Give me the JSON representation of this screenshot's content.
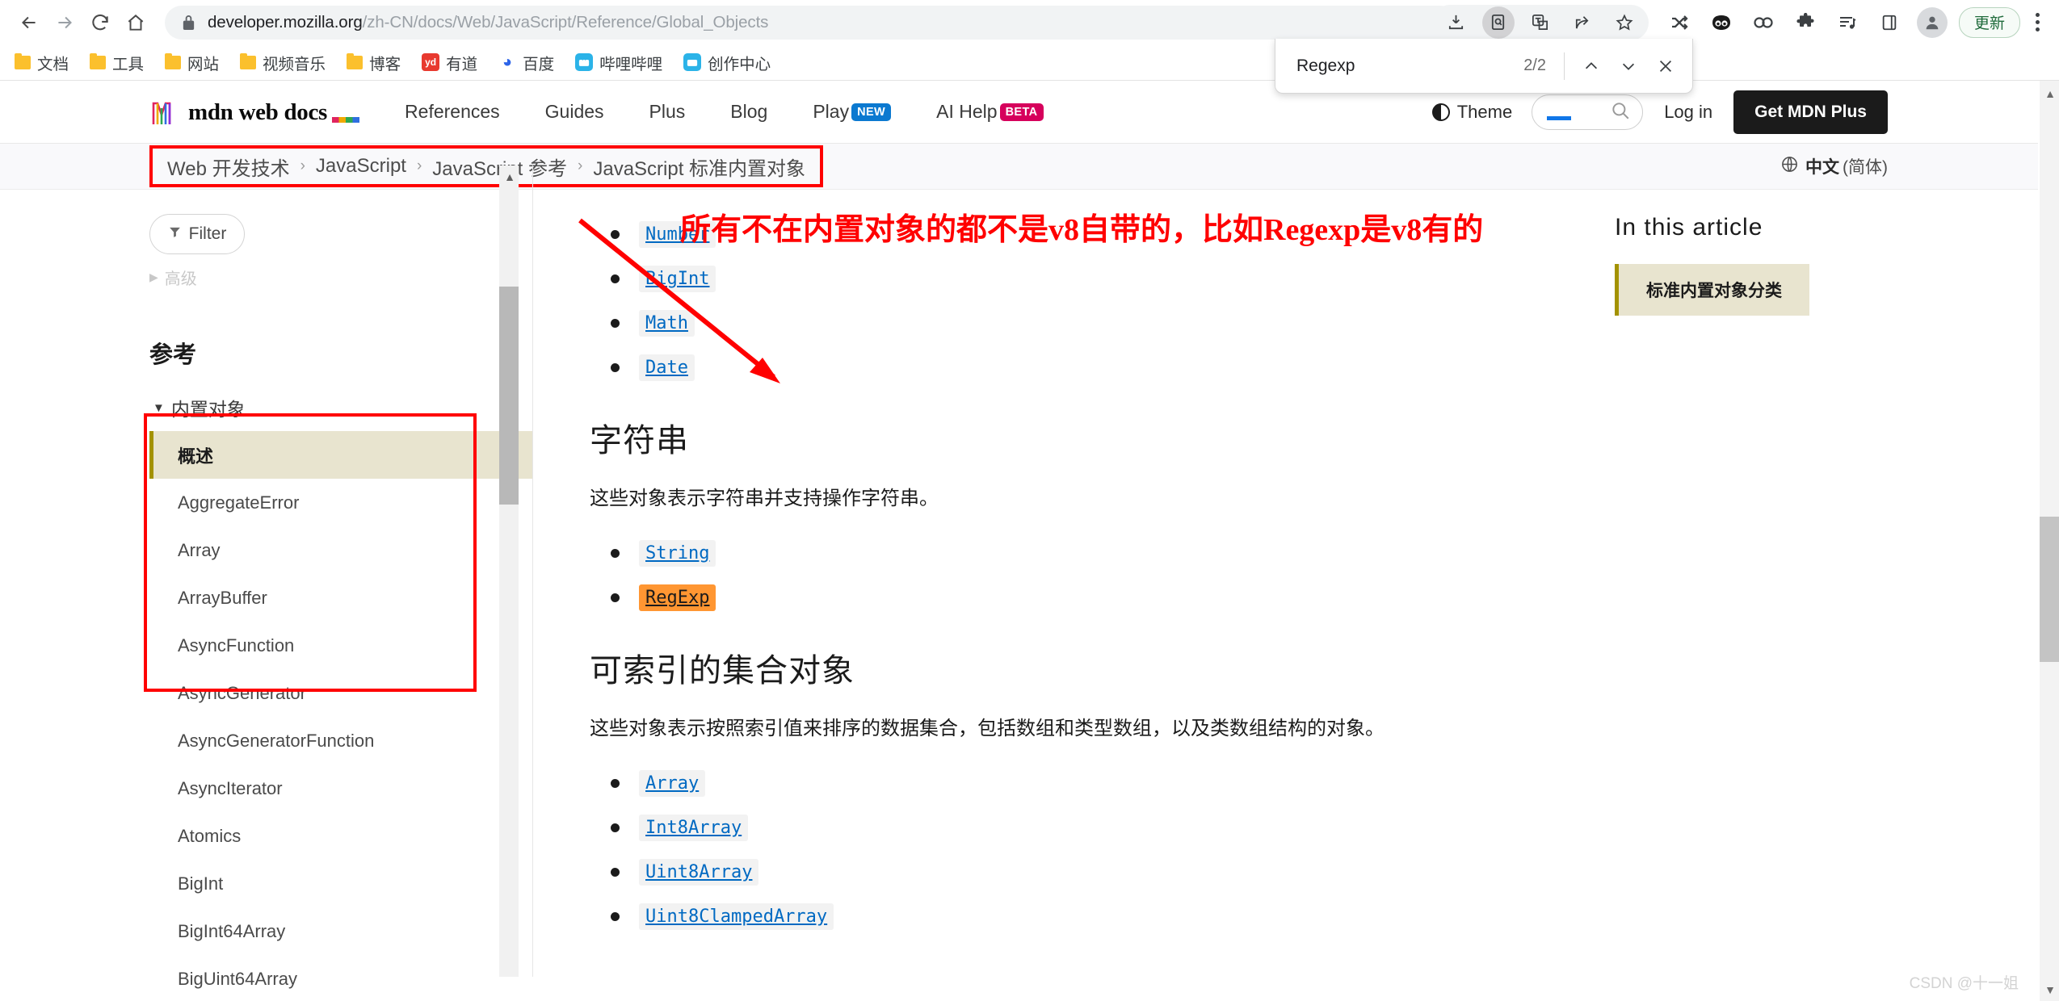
{
  "browser": {
    "nav": {
      "back": "back-arrow",
      "forward": "forward-arrow",
      "reload": "reload",
      "home": "home"
    },
    "url": {
      "host": "developer.mozilla.org",
      "path": "/zh-CN/docs/Web/JavaScript/Reference/Global_Objects",
      "lock_icon": "lock-icon"
    },
    "bookmarks": [
      {
        "label": "文档",
        "icon": "folder"
      },
      {
        "label": "工具",
        "icon": "folder"
      },
      {
        "label": "网站",
        "icon": "folder"
      },
      {
        "label": "视频音乐",
        "icon": "folder"
      },
      {
        "label": "博客",
        "icon": "folder"
      },
      {
        "label": "有道",
        "icon": "youdao",
        "icon_text": "yd",
        "color": "#e8392f"
      },
      {
        "label": "百度",
        "icon": "baidu",
        "icon_text": "",
        "color": "#2d64e8"
      },
      {
        "label": "哔哩哔哩",
        "icon": "bilibili",
        "icon_text": "",
        "color": "#2bb3e8"
      },
      {
        "label": "创作中心",
        "icon": "bilibili",
        "icon_text": "",
        "color": "#2bb3e8"
      }
    ],
    "toolbar_right": {
      "download_icon": "download-icon",
      "find_icon": "find-in-page-icon",
      "translate_icon": "translate-icon",
      "share_icon": "share-icon",
      "bookmark_icon": "star-icon",
      "shuffle_icon": "shuffle-icon",
      "panda_icon": "panda-icon",
      "link_icon": "link-icon",
      "extensions_icon": "puzzle-icon",
      "playlist_icon": "playlist-icon",
      "sidepanel_icon": "side-panel-icon",
      "profile_icon": "profile-avatar",
      "update_label": "更新",
      "menu_icon": "three-dots-menu"
    },
    "find_bar": {
      "query": "Regexp",
      "count": "2/2",
      "prev_icon": "chevron-up-icon",
      "next_icon": "chevron-down-icon",
      "close_icon": "close-icon"
    }
  },
  "mdn": {
    "logo_text": "mdn web docs",
    "nav": [
      {
        "label": "References",
        "badge": ""
      },
      {
        "label": "Guides",
        "badge": ""
      },
      {
        "label": "Plus",
        "badge": ""
      },
      {
        "label": "Blog",
        "badge": ""
      },
      {
        "label": "Play",
        "badge": "NEW"
      },
      {
        "label": "AI Help",
        "badge": "BETA"
      }
    ],
    "theme_label": "Theme",
    "search_icon": "search-icon",
    "login_label": "Log in",
    "get_plus_label": "Get MDN Plus",
    "breadcrumb": [
      "Web 开发技术",
      "JavaScript",
      "JavaScript 参考",
      "JavaScript 标准内置对象"
    ],
    "breadcrumb_separator": "›",
    "language": {
      "icon": "globe-icon",
      "name": "中文",
      "variant": "(简体)"
    }
  },
  "sidebar": {
    "filter_label": "Filter",
    "filter_icon": "filter-icon",
    "advanced_label": "高级",
    "section_title": "参考",
    "group_label": "内置对象",
    "items": [
      {
        "label": "概述",
        "current": true
      },
      {
        "label": "AggregateError",
        "current": false
      },
      {
        "label": "Array",
        "current": false
      },
      {
        "label": "ArrayBuffer",
        "current": false
      },
      {
        "label": "AsyncFunction",
        "current": false
      },
      {
        "label": "AsyncGenerator",
        "current": false
      },
      {
        "label": "AsyncGeneratorFunction",
        "current": false
      },
      {
        "label": "AsyncIterator",
        "current": false
      },
      {
        "label": "Atomics",
        "current": false
      },
      {
        "label": "BigInt",
        "current": false
      },
      {
        "label": "BigInt64Array",
        "current": false
      },
      {
        "label": "BigUint64Array",
        "current": false
      }
    ]
  },
  "main": {
    "annotation": "所有不在内置对象的都不是v8自带的，比如Regexp是v8有的",
    "top_list": [
      {
        "label": "Number",
        "highlight": false
      },
      {
        "label": "BigInt",
        "highlight": false
      },
      {
        "label": "Math",
        "highlight": false
      },
      {
        "label": "Date",
        "highlight": false
      }
    ],
    "sections": [
      {
        "heading": "字符串",
        "desc": "这些对象表示字符串并支持操作字符串。",
        "items": [
          {
            "label": "String",
            "highlight": false
          },
          {
            "label": "RegExp",
            "highlight": true
          }
        ]
      },
      {
        "heading": "可索引的集合对象",
        "desc": "这些对象表示按照索引值来排序的数据集合，包括数组和类型数组，以及类数组结构的对象。",
        "items": [
          {
            "label": "Array",
            "highlight": false
          },
          {
            "label": "Int8Array",
            "highlight": false
          },
          {
            "label": "Uint8Array",
            "highlight": false
          },
          {
            "label": "Uint8ClampedArray",
            "highlight": false
          }
        ]
      }
    ]
  },
  "toc": {
    "title": "In this article",
    "item": "标准内置对象分类"
  },
  "watermark": "CSDN @十一姐",
  "colors": {
    "accent_blue": "#0069c2",
    "highlight_orange": "#ff9632",
    "annotation_red": "#ff0000",
    "current_bg": "#e8e4cf",
    "current_bar": "#a39200"
  }
}
